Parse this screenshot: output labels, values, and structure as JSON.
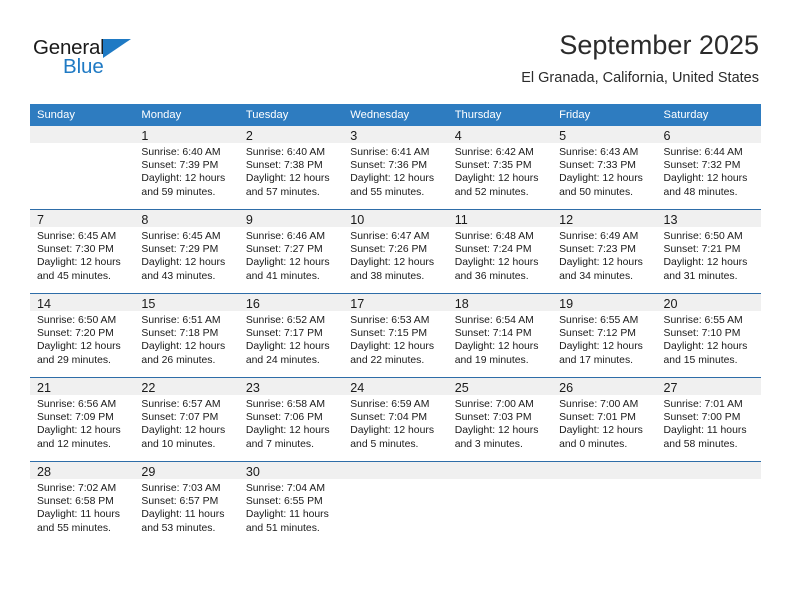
{
  "brand": {
    "name_top": "General",
    "name_bottom": "Blue",
    "triangle_icon": "triangle-logo-icon",
    "accent_color": "#1f7ac4"
  },
  "header": {
    "title": "September 2025",
    "location": "El Granada, California, United States"
  },
  "theme": {
    "header_blue": "#2e7cc0",
    "row_divider_blue": "#2e6da8",
    "daynum_band": "#f0f0f0"
  },
  "weekday_headers": [
    "Sunday",
    "Monday",
    "Tuesday",
    "Wednesday",
    "Thursday",
    "Friday",
    "Saturday"
  ],
  "weeks": [
    [
      {
        "day": "",
        "sunrise": "",
        "sunset": "",
        "daylight_line1": "",
        "daylight_line2": ""
      },
      {
        "day": "1",
        "sunrise": "Sunrise: 6:40 AM",
        "sunset": "Sunset: 7:39 PM",
        "daylight_line1": "Daylight: 12 hours",
        "daylight_line2": "and 59 minutes."
      },
      {
        "day": "2",
        "sunrise": "Sunrise: 6:40 AM",
        "sunset": "Sunset: 7:38 PM",
        "daylight_line1": "Daylight: 12 hours",
        "daylight_line2": "and 57 minutes."
      },
      {
        "day": "3",
        "sunrise": "Sunrise: 6:41 AM",
        "sunset": "Sunset: 7:36 PM",
        "daylight_line1": "Daylight: 12 hours",
        "daylight_line2": "and 55 minutes."
      },
      {
        "day": "4",
        "sunrise": "Sunrise: 6:42 AM",
        "sunset": "Sunset: 7:35 PM",
        "daylight_line1": "Daylight: 12 hours",
        "daylight_line2": "and 52 minutes."
      },
      {
        "day": "5",
        "sunrise": "Sunrise: 6:43 AM",
        "sunset": "Sunset: 7:33 PM",
        "daylight_line1": "Daylight: 12 hours",
        "daylight_line2": "and 50 minutes."
      },
      {
        "day": "6",
        "sunrise": "Sunrise: 6:44 AM",
        "sunset": "Sunset: 7:32 PM",
        "daylight_line1": "Daylight: 12 hours",
        "daylight_line2": "and 48 minutes."
      }
    ],
    [
      {
        "day": "7",
        "sunrise": "Sunrise: 6:45 AM",
        "sunset": "Sunset: 7:30 PM",
        "daylight_line1": "Daylight: 12 hours",
        "daylight_line2": "and 45 minutes."
      },
      {
        "day": "8",
        "sunrise": "Sunrise: 6:45 AM",
        "sunset": "Sunset: 7:29 PM",
        "daylight_line1": "Daylight: 12 hours",
        "daylight_line2": "and 43 minutes."
      },
      {
        "day": "9",
        "sunrise": "Sunrise: 6:46 AM",
        "sunset": "Sunset: 7:27 PM",
        "daylight_line1": "Daylight: 12 hours",
        "daylight_line2": "and 41 minutes."
      },
      {
        "day": "10",
        "sunrise": "Sunrise: 6:47 AM",
        "sunset": "Sunset: 7:26 PM",
        "daylight_line1": "Daylight: 12 hours",
        "daylight_line2": "and 38 minutes."
      },
      {
        "day": "11",
        "sunrise": "Sunrise: 6:48 AM",
        "sunset": "Sunset: 7:24 PM",
        "daylight_line1": "Daylight: 12 hours",
        "daylight_line2": "and 36 minutes."
      },
      {
        "day": "12",
        "sunrise": "Sunrise: 6:49 AM",
        "sunset": "Sunset: 7:23 PM",
        "daylight_line1": "Daylight: 12 hours",
        "daylight_line2": "and 34 minutes."
      },
      {
        "day": "13",
        "sunrise": "Sunrise: 6:50 AM",
        "sunset": "Sunset: 7:21 PM",
        "daylight_line1": "Daylight: 12 hours",
        "daylight_line2": "and 31 minutes."
      }
    ],
    [
      {
        "day": "14",
        "sunrise": "Sunrise: 6:50 AM",
        "sunset": "Sunset: 7:20 PM",
        "daylight_line1": "Daylight: 12 hours",
        "daylight_line2": "and 29 minutes."
      },
      {
        "day": "15",
        "sunrise": "Sunrise: 6:51 AM",
        "sunset": "Sunset: 7:18 PM",
        "daylight_line1": "Daylight: 12 hours",
        "daylight_line2": "and 26 minutes."
      },
      {
        "day": "16",
        "sunrise": "Sunrise: 6:52 AM",
        "sunset": "Sunset: 7:17 PM",
        "daylight_line1": "Daylight: 12 hours",
        "daylight_line2": "and 24 minutes."
      },
      {
        "day": "17",
        "sunrise": "Sunrise: 6:53 AM",
        "sunset": "Sunset: 7:15 PM",
        "daylight_line1": "Daylight: 12 hours",
        "daylight_line2": "and 22 minutes."
      },
      {
        "day": "18",
        "sunrise": "Sunrise: 6:54 AM",
        "sunset": "Sunset: 7:14 PM",
        "daylight_line1": "Daylight: 12 hours",
        "daylight_line2": "and 19 minutes."
      },
      {
        "day": "19",
        "sunrise": "Sunrise: 6:55 AM",
        "sunset": "Sunset: 7:12 PM",
        "daylight_line1": "Daylight: 12 hours",
        "daylight_line2": "and 17 minutes."
      },
      {
        "day": "20",
        "sunrise": "Sunrise: 6:55 AM",
        "sunset": "Sunset: 7:10 PM",
        "daylight_line1": "Daylight: 12 hours",
        "daylight_line2": "and 15 minutes."
      }
    ],
    [
      {
        "day": "21",
        "sunrise": "Sunrise: 6:56 AM",
        "sunset": "Sunset: 7:09 PM",
        "daylight_line1": "Daylight: 12 hours",
        "daylight_line2": "and 12 minutes."
      },
      {
        "day": "22",
        "sunrise": "Sunrise: 6:57 AM",
        "sunset": "Sunset: 7:07 PM",
        "daylight_line1": "Daylight: 12 hours",
        "daylight_line2": "and 10 minutes."
      },
      {
        "day": "23",
        "sunrise": "Sunrise: 6:58 AM",
        "sunset": "Sunset: 7:06 PM",
        "daylight_line1": "Daylight: 12 hours",
        "daylight_line2": "and 7 minutes."
      },
      {
        "day": "24",
        "sunrise": "Sunrise: 6:59 AM",
        "sunset": "Sunset: 7:04 PM",
        "daylight_line1": "Daylight: 12 hours",
        "daylight_line2": "and 5 minutes."
      },
      {
        "day": "25",
        "sunrise": "Sunrise: 7:00 AM",
        "sunset": "Sunset: 7:03 PM",
        "daylight_line1": "Daylight: 12 hours",
        "daylight_line2": "and 3 minutes."
      },
      {
        "day": "26",
        "sunrise": "Sunrise: 7:00 AM",
        "sunset": "Sunset: 7:01 PM",
        "daylight_line1": "Daylight: 12 hours",
        "daylight_line2": "and 0 minutes."
      },
      {
        "day": "27",
        "sunrise": "Sunrise: 7:01 AM",
        "sunset": "Sunset: 7:00 PM",
        "daylight_line1": "Daylight: 11 hours",
        "daylight_line2": "and 58 minutes."
      }
    ],
    [
      {
        "day": "28",
        "sunrise": "Sunrise: 7:02 AM",
        "sunset": "Sunset: 6:58 PM",
        "daylight_line1": "Daylight: 11 hours",
        "daylight_line2": "and 55 minutes."
      },
      {
        "day": "29",
        "sunrise": "Sunrise: 7:03 AM",
        "sunset": "Sunset: 6:57 PM",
        "daylight_line1": "Daylight: 11 hours",
        "daylight_line2": "and 53 minutes."
      },
      {
        "day": "30",
        "sunrise": "Sunrise: 7:04 AM",
        "sunset": "Sunset: 6:55 PM",
        "daylight_line1": "Daylight: 11 hours",
        "daylight_line2": "and 51 minutes."
      },
      {
        "day": "",
        "sunrise": "",
        "sunset": "",
        "daylight_line1": "",
        "daylight_line2": ""
      },
      {
        "day": "",
        "sunrise": "",
        "sunset": "",
        "daylight_line1": "",
        "daylight_line2": ""
      },
      {
        "day": "",
        "sunrise": "",
        "sunset": "",
        "daylight_line1": "",
        "daylight_line2": ""
      },
      {
        "day": "",
        "sunrise": "",
        "sunset": "",
        "daylight_line1": "",
        "daylight_line2": ""
      }
    ]
  ]
}
